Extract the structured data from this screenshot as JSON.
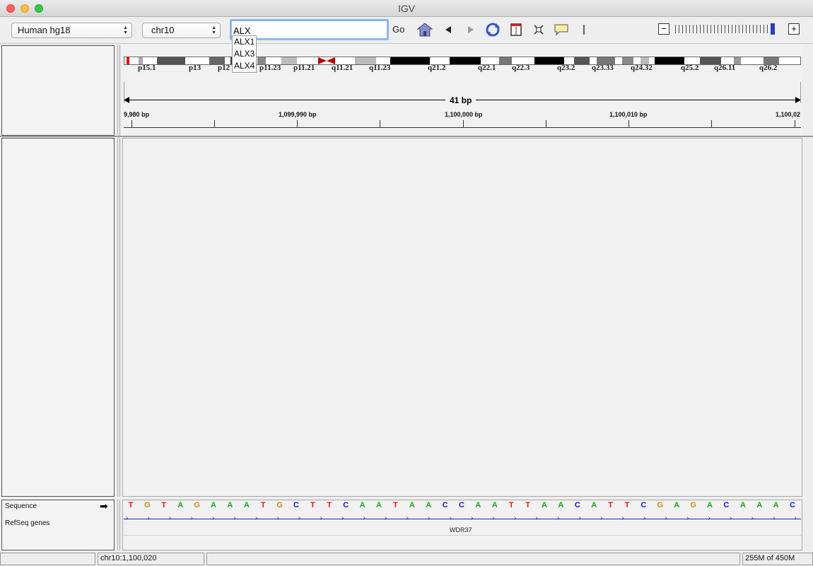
{
  "window": {
    "title": "IGV"
  },
  "toolbar": {
    "genome_value": "Human hg18",
    "chromosome_value": "chr10",
    "search_value": "ALX",
    "go_label": "Go"
  },
  "autocomplete": [
    "ALX1",
    "ALX3",
    "ALX4"
  ],
  "ideogram": {
    "band_labels": [
      "p15.1",
      "p13",
      "p12",
      "p11.23",
      "p11.21",
      "q11.21",
      "q11.23",
      "q21.2",
      "q22.1",
      "q22.3",
      "q23.2",
      "q23.33",
      "q24.32",
      "q25.2",
      "q26.11",
      "q26.2"
    ]
  },
  "ruler": {
    "span_label": "41 bp",
    "ticks": [
      "9,980 bp",
      "1,099,990 bp",
      "1,100,000 bp",
      "1,100,010 bp",
      "1,100,02"
    ]
  },
  "tracks": {
    "sequence_name": "Sequence",
    "genes_name": "RefSeq genes",
    "gene_label": "WDR37",
    "bases": [
      "T",
      "G",
      "T",
      "A",
      "G",
      "A",
      "A",
      "A",
      "T",
      "G",
      "C",
      "T",
      "T",
      "C",
      "A",
      "A",
      "T",
      "A",
      "A",
      "C",
      "C",
      "A",
      "A",
      "T",
      "T",
      "A",
      "A",
      "C",
      "A",
      "T",
      "T",
      "C",
      "G",
      "A",
      "G",
      "A",
      "C",
      "A",
      "A",
      "A",
      "C"
    ],
    "base_colors": {
      "A": "#1ba51b",
      "C": "#1b1bd6",
      "G": "#d08a1c",
      "T": "#e0201e"
    }
  },
  "status": {
    "locus": "chr10:1,100,020",
    "memory": "255M of 450M"
  }
}
